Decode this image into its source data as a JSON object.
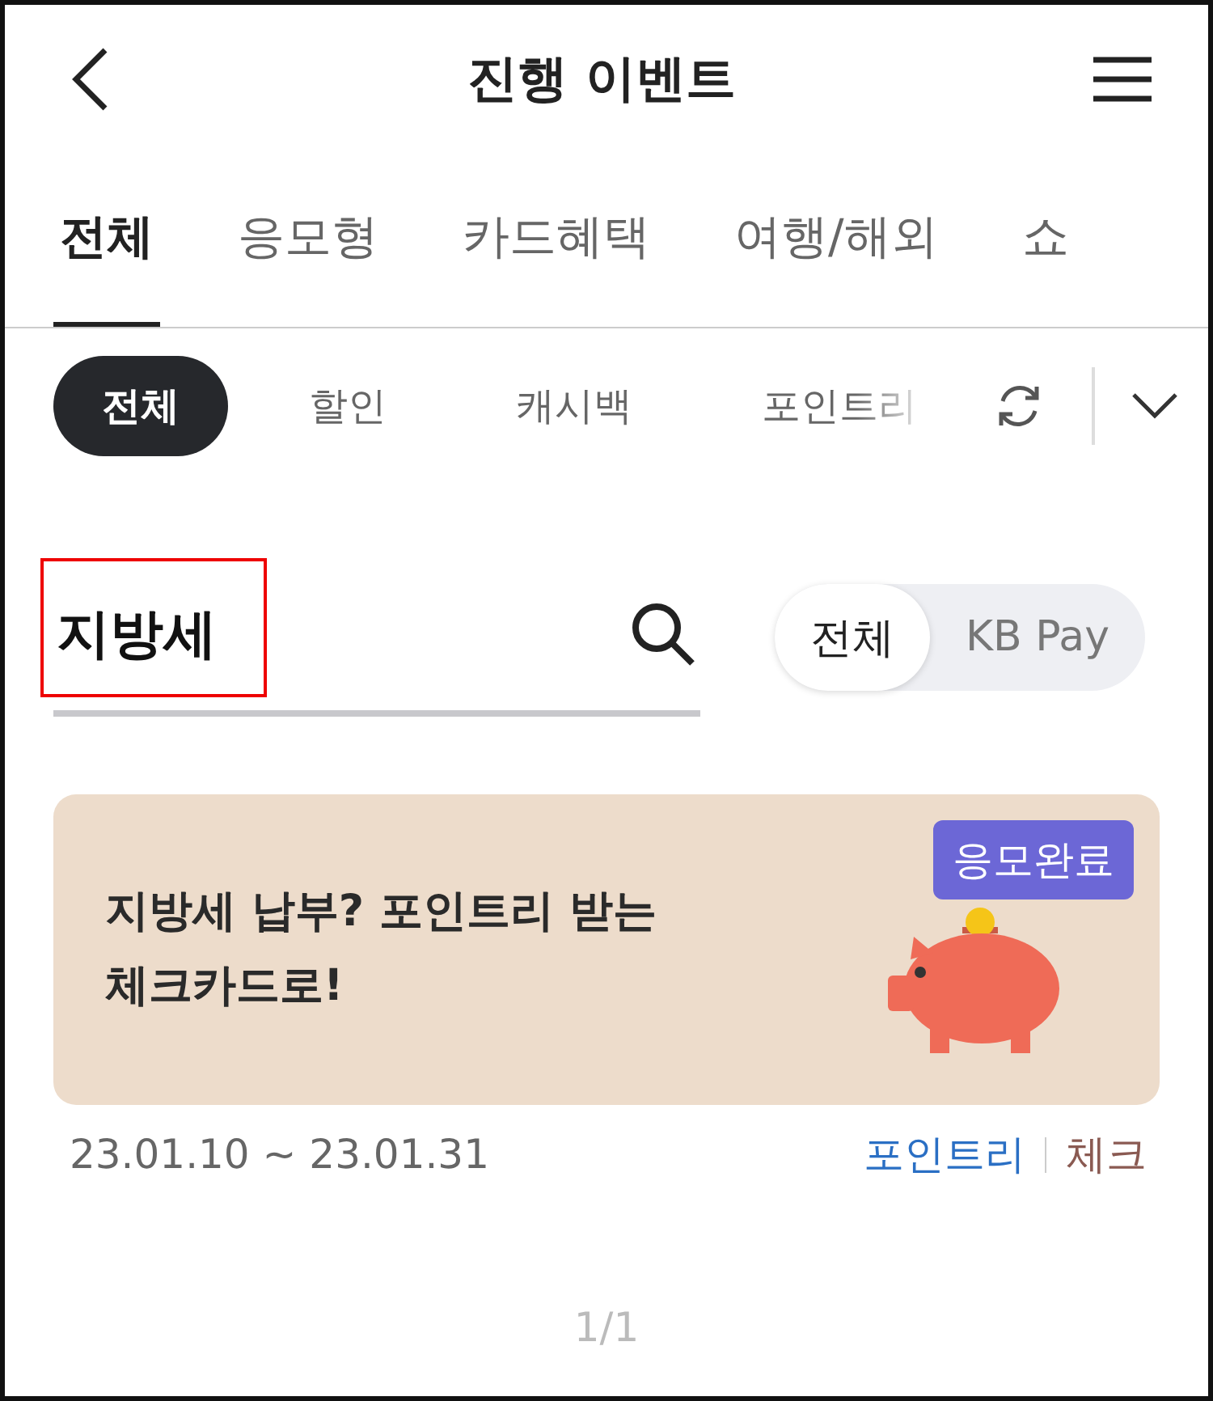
{
  "header": {
    "title": "진행 이벤트"
  },
  "tabs": [
    {
      "label": "전체",
      "selected": true
    },
    {
      "label": "응모형",
      "selected": false
    },
    {
      "label": "카드혜택",
      "selected": false
    },
    {
      "label": "여행/해외",
      "selected": false
    },
    {
      "label": "쇼",
      "selected": false
    }
  ],
  "chips": [
    {
      "label": "전체",
      "selected": true
    },
    {
      "label": "할인",
      "selected": false
    },
    {
      "label": "캐시백",
      "selected": false
    },
    {
      "label": "포인트리",
      "selected": false
    }
  ],
  "search": {
    "value": "지방세",
    "highlighted": true
  },
  "segment": [
    {
      "label": "전체",
      "selected": true
    },
    {
      "label": "KB Pay",
      "selected": false
    }
  ],
  "events": [
    {
      "title": "지방세 납부? 포인트리 받는\n체크카드로!",
      "badge": "응모완료",
      "period": "23.01.10 ~ 23.01.31",
      "tags": [
        {
          "label": "포인트리",
          "color": "#2a6fc4"
        },
        {
          "label": "체크",
          "color": "#8a5a52"
        }
      ]
    }
  ],
  "pagination": "1/1"
}
